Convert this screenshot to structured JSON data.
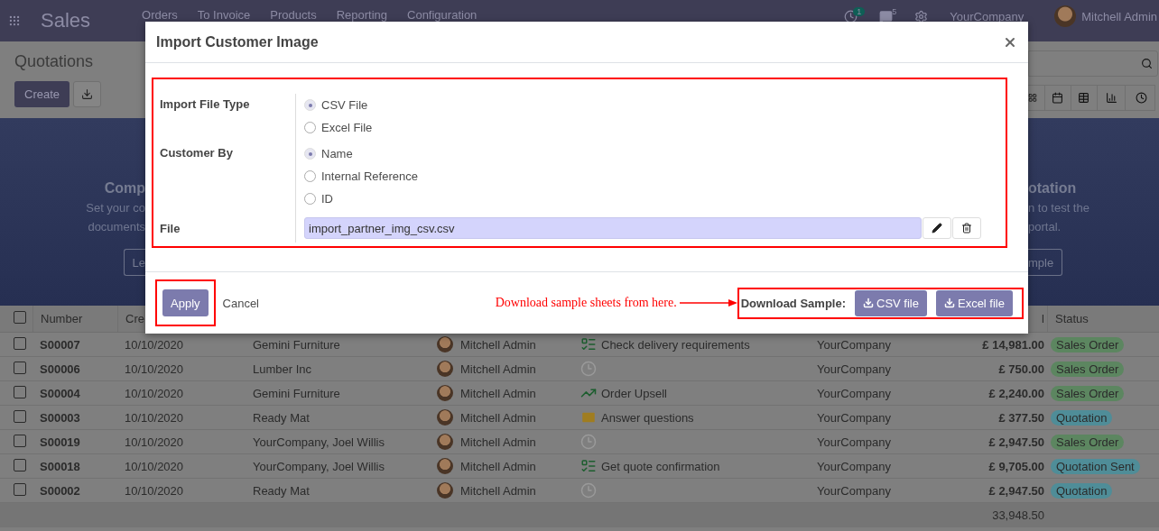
{
  "app": {
    "title": "Sales",
    "menu": [
      "Orders",
      "To Invoice",
      "Products",
      "Reporting",
      "Configuration"
    ],
    "activity_count": "1",
    "message_count": "5",
    "company": "YourCompany",
    "user": "Mitchell Admin"
  },
  "control_panel": {
    "title": "Quotations",
    "create_label": "Create",
    "views": [
      {
        "kind": "kanban"
      },
      {
        "kind": "calendar"
      },
      {
        "kind": "list"
      },
      {
        "kind": "graph"
      },
      {
        "kind": "activity"
      }
    ]
  },
  "banner": {
    "left_title": "Comp",
    "left_lines": [
      "Set your co",
      "documents"
    ],
    "left_button": "Le",
    "right_title": "otation",
    "right_lines": [
      "n to test the",
      "portal."
    ],
    "right_button": "mple"
  },
  "table": {
    "all_checked": false,
    "columns": [
      "Number",
      "Cre",
      "l",
      "Status"
    ],
    "rows": [
      {
        "checked": false,
        "number": "S00007",
        "date": "10/10/2020",
        "customer": "Gemini Furniture",
        "salesperson": "Mitchell Admin",
        "activity": {
          "kind": "tasks",
          "text": "Check delivery requirements"
        },
        "company": "YourCompany",
        "total": "£ 14,981.00",
        "status": {
          "label": "Sales Order",
          "color": "#5c8660"
        }
      },
      {
        "checked": false,
        "number": "S00006",
        "date": "10/10/2020",
        "customer": "Lumber Inc",
        "salesperson": "Mitchell Admin",
        "activity": {
          "kind": "clock"
        },
        "company": "YourCompany",
        "total": "£ 750.00",
        "status": {
          "label": "Sales Order",
          "color": "#5c8660"
        }
      },
      {
        "checked": false,
        "number": "S00004",
        "date": "10/10/2020",
        "customer": "Gemini Furniture",
        "salesperson": "Mitchell Admin",
        "activity": {
          "kind": "chart",
          "text": "Order Upsell"
        },
        "company": "YourCompany",
        "total": "£ 2,240.00",
        "status": {
          "label": "Sales Order",
          "color": "#5c8660"
        }
      },
      {
        "checked": false,
        "number": "S00003",
        "date": "10/10/2020",
        "customer": "Ready Mat",
        "salesperson": "Mitchell Admin",
        "activity": {
          "kind": "envelope",
          "text": "Answer questions"
        },
        "company": "YourCompany",
        "total": "£ 377.50",
        "status": {
          "label": "Quotation",
          "color": "#4f8d98"
        }
      },
      {
        "checked": false,
        "number": "S00019",
        "date": "10/10/2020",
        "customer": "YourCompany, Joel Willis",
        "salesperson": "Mitchell Admin",
        "activity": {
          "kind": "clock"
        },
        "company": "YourCompany",
        "total": "£ 2,947.50",
        "status": {
          "label": "Sales Order",
          "color": "#5c8660"
        }
      },
      {
        "checked": false,
        "number": "S00018",
        "date": "10/10/2020",
        "customer": "YourCompany, Joel Willis",
        "salesperson": "Mitchell Admin",
        "activity": {
          "kind": "tasks",
          "text": "Get quote confirmation"
        },
        "company": "YourCompany",
        "total": "£ 9,705.00",
        "status": {
          "label": "Quotation Sent",
          "color": "#4f8d98"
        }
      },
      {
        "checked": false,
        "number": "S00002",
        "date": "10/10/2020",
        "customer": "Ready Mat",
        "salesperson": "Mitchell Admin",
        "activity": {
          "kind": "clock"
        },
        "company": "YourCompany",
        "total": "£ 2,947.50",
        "status": {
          "label": "Quotation",
          "color": "#4f8d98"
        }
      }
    ],
    "total": "33,948.50"
  },
  "dialog": {
    "title": "Import Customer Image",
    "fields": [
      {
        "label": "Import File Type",
        "kind": "radio",
        "options": [
          {
            "label": "CSV File",
            "selected": true
          },
          {
            "label": "Excel File",
            "selected": false
          }
        ]
      },
      {
        "label": "Customer By",
        "kind": "radio",
        "options": [
          {
            "label": "Name",
            "selected": true
          },
          {
            "label": "Internal Reference",
            "selected": false
          },
          {
            "label": "ID",
            "selected": false
          }
        ]
      },
      {
        "label": "File",
        "kind": "file",
        "value": "import_partner_img_csv.csv"
      }
    ],
    "apply": "Apply",
    "cancel": "Cancel",
    "note": "Download sample sheets from here.",
    "sample_label": "Download Sample:",
    "sample_buttons": [
      "CSV file",
      "Excel file"
    ]
  }
}
